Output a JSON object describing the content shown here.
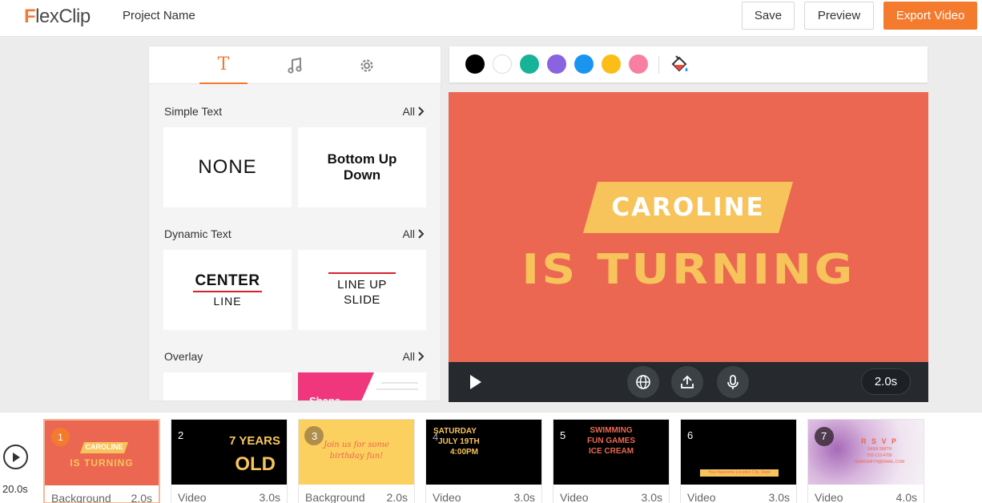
{
  "header": {
    "logo_first": "F",
    "logo_rest": "lexClip",
    "project_name": "Project Name",
    "save_label": "Save",
    "preview_label": "Preview",
    "export_label": "Export Video"
  },
  "panel": {
    "tab_text_glyph": "T",
    "sections": [
      {
        "title": "Simple Text",
        "all": "All"
      },
      {
        "title": "Dynamic Text",
        "all": "All"
      },
      {
        "title": "Overlay",
        "all": "All"
      }
    ],
    "cards": {
      "none": "NONE",
      "bottom_up_line1": "Bottom Up",
      "bottom_up_line2": "Down",
      "center_top": "CENTER",
      "center_bottom": "LINE",
      "lineup_line1": "LINE UP",
      "lineup_line2": "SLIDE",
      "overlay_shape": "Shape"
    }
  },
  "colors": [
    "#000000",
    "#ffffff",
    "#17b397",
    "#8a63e0",
    "#1a95ef",
    "#fbbd17",
    "#f77fa2"
  ],
  "canvas": {
    "line1": "CAROLINE",
    "line2": "IS TURNING",
    "duration": "2.0s"
  },
  "timeline": {
    "total": "20.0s",
    "clips": [
      {
        "num": "1",
        "type": "Background",
        "dur": "2.0s",
        "t1": "CAROLINE",
        "t2": "IS TURNING"
      },
      {
        "num": "2",
        "type": "Video",
        "dur": "3.0s",
        "t1": "7 YEARS",
        "t2": "OLD"
      },
      {
        "num": "3",
        "type": "Background",
        "dur": "2.0s",
        "t1": "Join us for some",
        "t2": "birthday fun!"
      },
      {
        "num": "4",
        "type": "Video",
        "dur": "3.0s",
        "t1": "SATURDAY",
        "t2": "JULY 19TH",
        "t3": "4:00PM"
      },
      {
        "num": "5",
        "type": "Video",
        "dur": "3.0s",
        "t1": "SWIMMING",
        "t2": "FUN GAMES",
        "t3": "ICE CREAM"
      },
      {
        "num": "6",
        "type": "Video",
        "dur": "3.0s",
        "t1": "Your Awesome Location City, State"
      },
      {
        "num": "7",
        "type": "Video",
        "dur": "4.0s",
        "t1": "R S V P",
        "t2": "SARA SMITH",
        "t3": "555-123-4789",
        "t4": "SARASMITH@EMAIL.COM"
      }
    ]
  }
}
